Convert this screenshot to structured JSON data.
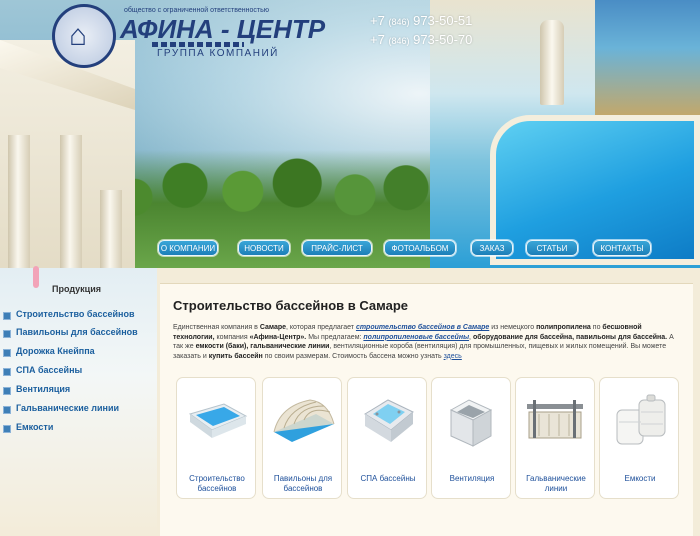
{
  "header": {
    "logo": {
      "tagline": "общество с ограниченной ответственностью",
      "brand": "АФИНА - ЦЕНТР",
      "subtitle": "ГРУППА КОМПАНИЙ"
    },
    "phones": [
      {
        "prefix": "+7",
        "code": "(846)",
        "number": "973-50-51"
      },
      {
        "prefix": "+7",
        "code": "(846)",
        "number": "973-50-70"
      }
    ]
  },
  "nav": [
    {
      "label": "О КОМПАНИИ"
    },
    {
      "label": "НОВОСТИ"
    },
    {
      "label": "ПРАЙС-ЛИСТ"
    },
    {
      "label": "ФОТОАЛЬБОМ"
    },
    {
      "label": "ЗАКАЗ"
    },
    {
      "label": "СТАТЬИ"
    },
    {
      "label": "КОНТАКТЫ"
    }
  ],
  "sidebar": {
    "title": "Продукция",
    "items": [
      {
        "label": "Строительство бассейнов"
      },
      {
        "label": "Павильоны для бассейнов"
      },
      {
        "label": "Дорожка Кнейппа"
      },
      {
        "label": "СПА бассейны"
      },
      {
        "label": "Вентиляция"
      },
      {
        "label": "Гальванические линии"
      },
      {
        "label": "Емкости"
      }
    ]
  },
  "main": {
    "title": "Строительство бассейнов в Самаре",
    "intro": {
      "p1": "Единственная компания в ",
      "p1b": "Самаре",
      "p2": ", которая предлагает  ",
      "link1": "строительство  бассейнов в Самаре",
      "p3": " из немецкого ",
      "p3b": "полипропилена",
      "p4": " по ",
      "p4b": "бесшовной технологии,",
      "p5": " компания ",
      "p5b": "«Афина-Центр».",
      "p6": " Мы предлагаем: ",
      "link2": "полипропиленовые бассейны",
      "p7": ",  ",
      "p7b": "оборудование для бассейна,  павильоны для бассейна.",
      "p8": " А так же ",
      "p8b": "емкости (баки), гальванические линии",
      "p9": ", вентиляционные короба (вентиляция) для промышленных, пищевых и жилых помещений.  Вы можете заказать и ",
      "p9b": "купить бассейн",
      "p10": " по  своим размерам. Стоимость бассена можно узнать ",
      "link3": "здесь"
    },
    "products": [
      {
        "label": "Строительство бассейнов",
        "icon": "pool-icon"
      },
      {
        "label": "Павильоны для бассейнов",
        "icon": "pavilion-icon"
      },
      {
        "label": "СПА бассейны",
        "icon": "spa-icon"
      },
      {
        "label": "Вентиляция",
        "icon": "duct-icon"
      },
      {
        "label": "Гальванические линии",
        "icon": "galvanic-icon"
      },
      {
        "label": "Емкости",
        "icon": "tank-icon"
      }
    ]
  }
}
